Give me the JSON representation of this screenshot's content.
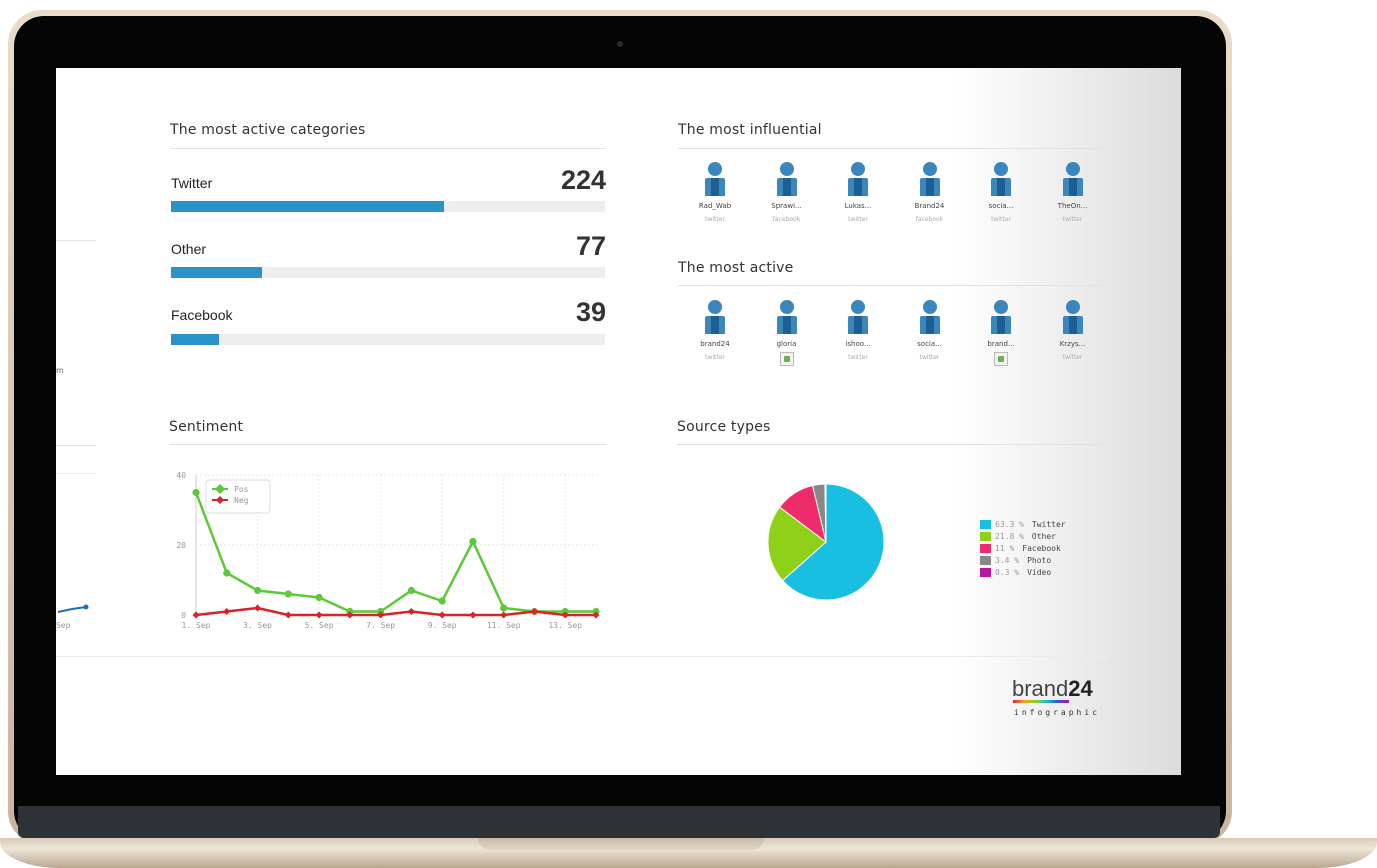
{
  "categories_section": {
    "title": "The most active categories",
    "items": [
      {
        "label": "Twitter",
        "value": "224",
        "fraction": 0.63
      },
      {
        "label": "Other",
        "value": "77",
        "fraction": 0.21
      },
      {
        "label": "Facebook",
        "value": "39",
        "fraction": 0.11
      }
    ]
  },
  "influential_section": {
    "title": "The most influential",
    "people": [
      {
        "name": "Rad_Wab",
        "source": "twitter"
      },
      {
        "name": "Sprawi...",
        "source": "facebook"
      },
      {
        "name": "Lukas...",
        "source": "twitter"
      },
      {
        "name": "Brand24",
        "source": "facebook"
      },
      {
        "name": "socia...",
        "source": "twitter"
      },
      {
        "name": "TheOn...",
        "source": "twitter"
      }
    ]
  },
  "active_section": {
    "title": "The most active",
    "people": [
      {
        "name": "brand24",
        "source": "twitter",
        "broken_image": false
      },
      {
        "name": "gloria",
        "source": "",
        "broken_image": true
      },
      {
        "name": "ishoo...",
        "source": "twitter",
        "broken_image": false
      },
      {
        "name": "socia...",
        "source": "twitter",
        "broken_image": false
      },
      {
        "name": "brand...",
        "source": "",
        "broken_image": true
      },
      {
        "name": "Krzys...",
        "source": "twitter",
        "broken_image": false
      }
    ]
  },
  "sentiment_section": {
    "title": "Sentiment"
  },
  "source_types_section": {
    "title": "Source types"
  },
  "left_partial": {
    "tick_label": "Sep",
    "fragment": "m"
  },
  "logo": {
    "word_prefix": "brand",
    "word_number": "24",
    "subtitle": "infographic"
  },
  "chart_data": [
    {
      "type": "line",
      "title": "",
      "x": [
        "1. Sep",
        "2. Sep",
        "3. Sep",
        "4. Sep",
        "5. Sep",
        "6. Sep",
        "7. Sep",
        "8. Sep",
        "9. Sep",
        "10. Sep",
        "11. Sep",
        "12. Sep",
        "13. Sep",
        "14. Sep"
      ],
      "xtick_labels": [
        "1. Sep",
        "3. Sep",
        "5. Sep",
        "7. Sep",
        "9. Sep",
        "11. Sep",
        "13. Sep"
      ],
      "ylim": [
        0,
        40
      ],
      "yticks": [
        "0",
        "20",
        "40"
      ],
      "series": [
        {
          "name": "Pos",
          "color": "#5cc93a",
          "values": [
            35,
            12,
            7,
            6,
            5,
            1,
            1,
            7,
            4,
            21,
            2,
            1,
            1,
            1
          ]
        },
        {
          "name": "Neg",
          "color": "#d9222a",
          "values": [
            0,
            1,
            2,
            0,
            0,
            0,
            0,
            1,
            0,
            0,
            0,
            1,
            0,
            0
          ]
        }
      ],
      "legend": "top-left",
      "grid": true
    },
    {
      "type": "pie",
      "slices": [
        {
          "label": "Twitter",
          "percent_text": "63.3 %",
          "value": 63.3,
          "color": "#19bfe0"
        },
        {
          "label": "Other",
          "percent_text": "21.8 %",
          "value": 21.8,
          "color": "#8fd119"
        },
        {
          "label": "Facebook",
          "percent_text": "11 %",
          "value": 11,
          "color": "#ee2c6c"
        },
        {
          "label": "Photo",
          "percent_text": "3.4 %",
          "value": 3.4,
          "color": "#888888"
        },
        {
          "label": "Video",
          "percent_text": "0.3 %",
          "value": 0.3,
          "color": "#b5179e"
        }
      ],
      "legend": "right"
    }
  ]
}
